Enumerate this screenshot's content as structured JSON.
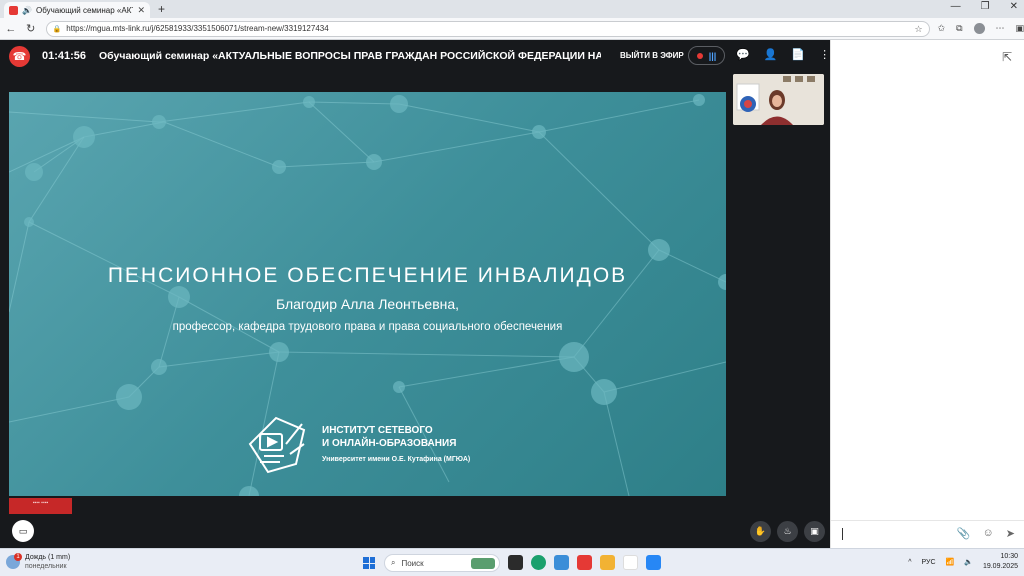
{
  "browser": {
    "tab_title": "Обучающий семинар «АКТУАЛ",
    "url": "https://mgua.mts-link.ru/j/62581933/3351506071/stream-new/3319127434"
  },
  "stream": {
    "timer": "01:41:56",
    "title": "Обучающий семинар «АКТУАЛЬНЫЕ ВОПРОСЫ ПРАВ ГРАЖДАН РОССИЙСКОЙ ФЕДЕРАЦИИ НА СОЦИАЛЬНОЕ",
    "exit_label": "ВЫЙТИ В ЭФИР",
    "recording_color": "#e53935"
  },
  "slide": {
    "title": "ПЕНСИОННОЕ ОБЕСПЕЧЕНИЕ ИНВАЛИДОВ",
    "author": "Благодир Алла Леонтьевна,",
    "role": "профессор, кафедра трудового права и права социального обеспечения",
    "institute_line1": "ИНСТИТУТ СЕТЕВОГО",
    "institute_line2": "И ОНЛАЙН-ОБРАЗОВАНИЯ",
    "university": "Университет имени О.Е. Кутафина (МГЮА)"
  },
  "taskbar": {
    "weather_title": "Дождь (1 mm)",
    "weather_sub": "понедельник",
    "weather_badge": "1",
    "search_placeholder": "Поиск",
    "language": "РУС",
    "time": "10:30",
    "date": "19.09.2025"
  },
  "colors": {
    "accent_red": "#e53935",
    "slide_teal": "#3e8f9a",
    "mic_blue": "#4fa3ff"
  }
}
